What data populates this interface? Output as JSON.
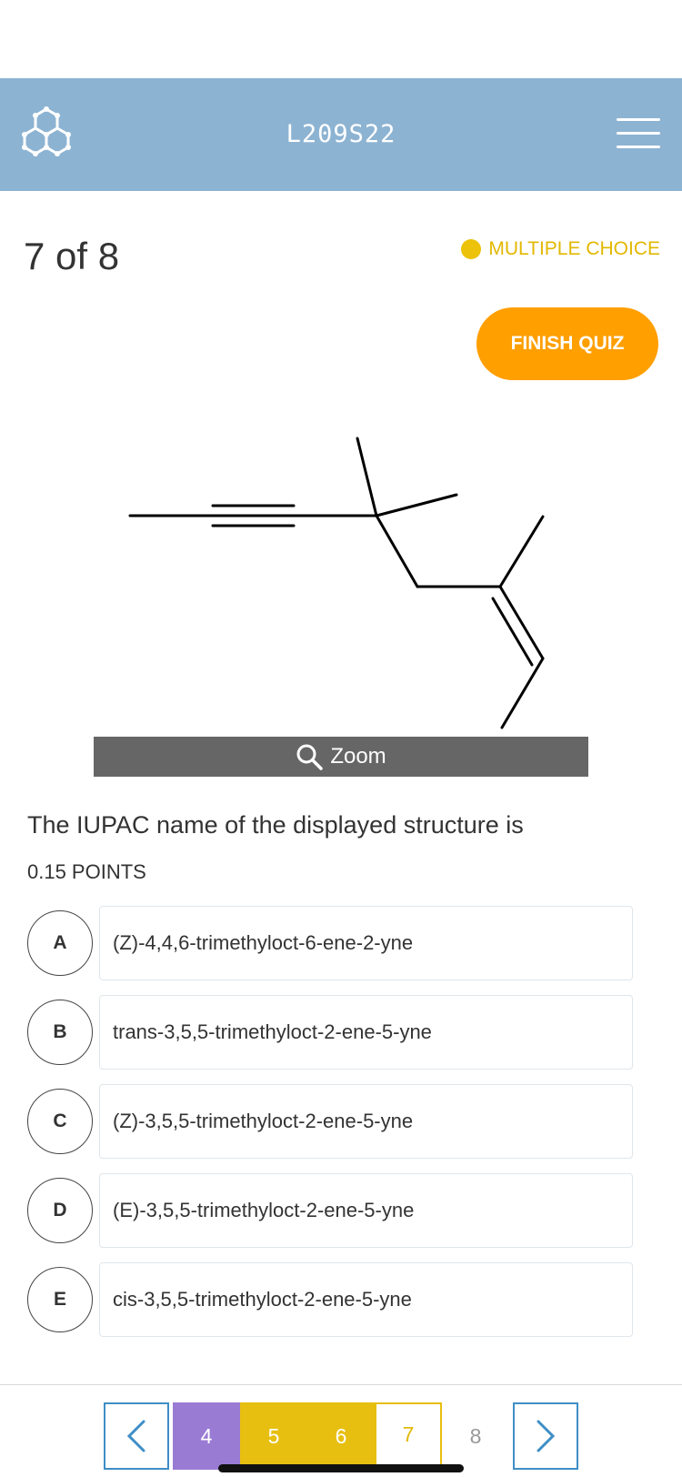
{
  "header": {
    "title": "L209S22",
    "logo_icon": "molecule-icon",
    "menu_icon": "hamburger-menu-icon"
  },
  "question_meta": {
    "counter": "7 of 8",
    "type_label": "MULTIPLE CHOICE",
    "type_color": "#ecc20b"
  },
  "finish_button": {
    "label": "FINISH QUIZ",
    "color": "#ff9f00"
  },
  "zoom": {
    "label": "Zoom",
    "icon": "magnifier-icon"
  },
  "question": {
    "text": "The IUPAC name of the displayed structure is",
    "points": "0.15 POINTS"
  },
  "options": [
    {
      "letter": "A",
      "text": "(Z)-4,4,6-trimethyloct-6-ene-2-yne"
    },
    {
      "letter": "B",
      "text": "trans-3,5,5-trimethyloct-2-ene-5-yne"
    },
    {
      "letter": "C",
      "text": "(Z)-3,5,5-trimethyloct-2-ene-5-yne"
    },
    {
      "letter": "D",
      "text": "(E)-3,5,5-trimethyloct-2-ene-5-yne"
    },
    {
      "letter": "E",
      "text": "cis-3,5,5-trimethyloct-2-ene-5-yne"
    }
  ],
  "pager": {
    "pages": [
      "4",
      "5",
      "6",
      "7",
      "8"
    ],
    "current": "7",
    "prev_icon": "chevron-left-icon",
    "next_icon": "chevron-right-icon"
  }
}
